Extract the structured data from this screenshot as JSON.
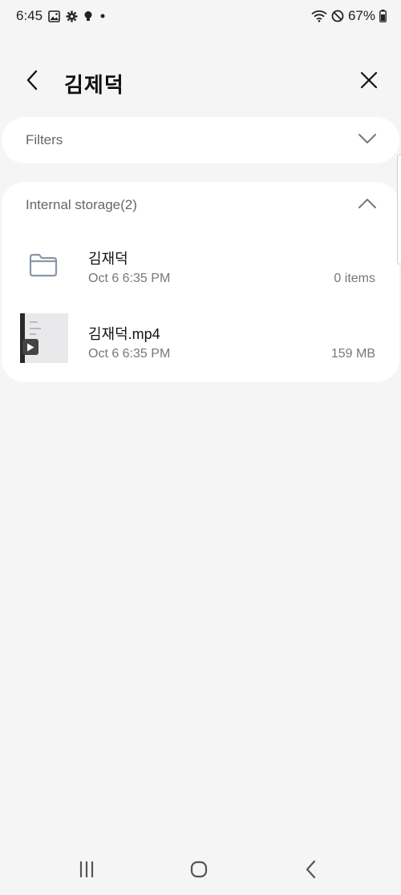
{
  "status_bar": {
    "time": "6:45",
    "battery": "67%",
    "icons": [
      "gallery-icon",
      "settings-icon",
      "bulb-icon",
      "dot-icon",
      "wifi-icon",
      "dnd-icon",
      "battery-icon"
    ]
  },
  "header": {
    "title": "김제덕",
    "back_icon": "chevron-left-icon",
    "close_icon": "close-icon"
  },
  "filters": {
    "label": "Filters",
    "icon": "chevron-down-icon"
  },
  "storage": {
    "label": "Internal storage(2)",
    "icon": "chevron-up-icon",
    "items": [
      {
        "type": "folder",
        "name": "김재덕",
        "date": "Oct 6 6:35 PM",
        "meta": "0 items",
        "icon": "folder-icon"
      },
      {
        "type": "video",
        "name": "김재덕.mp4",
        "date": "Oct 6 6:35 PM",
        "meta": "159 MB",
        "icon": "video-thumbnail"
      }
    ]
  },
  "nav": {
    "recent_icon": "recent-apps-icon",
    "home_icon": "home-icon",
    "back_icon": "back-icon"
  },
  "colors": {
    "background": "#f5f5f5",
    "card": "#ffffff",
    "secondary_text": "#777777",
    "folder_stroke": "#8a97a6"
  }
}
